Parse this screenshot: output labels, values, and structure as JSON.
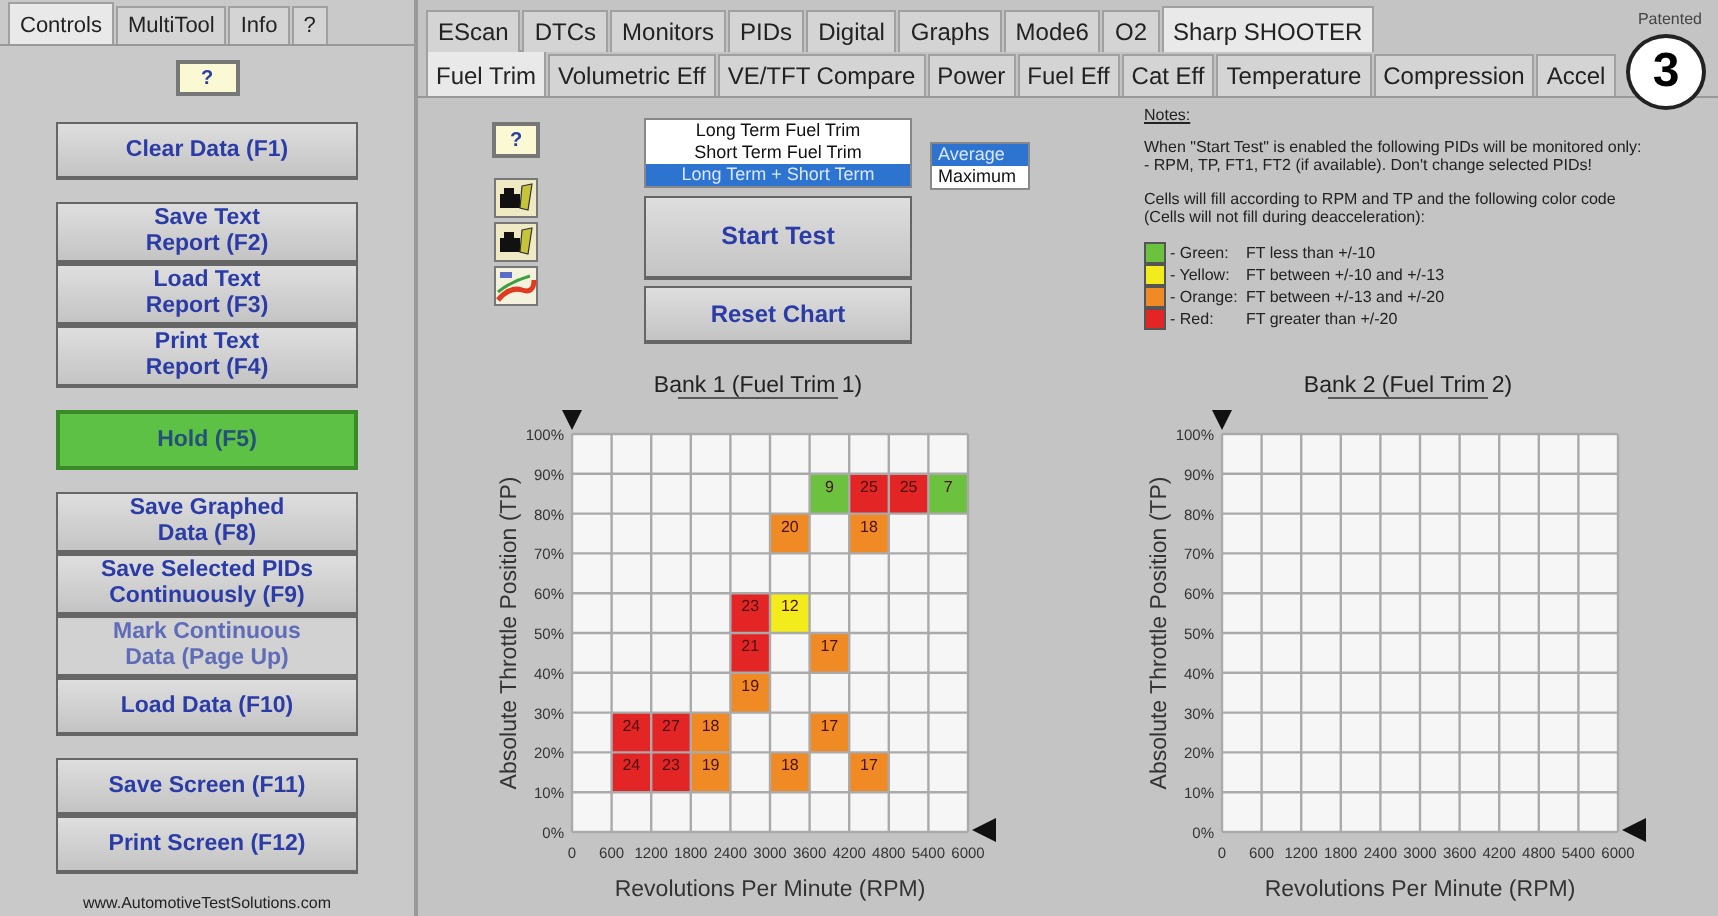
{
  "left_tabs": [
    {
      "label": "Controls",
      "selected": true
    },
    {
      "label": "MultiTool",
      "selected": false
    },
    {
      "label": "Info",
      "selected": false
    },
    {
      "label": "?",
      "selected": false
    }
  ],
  "help_button": "?",
  "button_groups": [
    [
      {
        "label": "Clear Data (F1)",
        "on": false,
        "disabled": false
      }
    ],
    [
      {
        "label": "Save Text\nReport (F2)",
        "on": false,
        "disabled": false
      },
      {
        "label": "Load Text\nReport (F3)",
        "on": false,
        "disabled": false
      },
      {
        "label": "Print Text\nReport (F4)",
        "on": false,
        "disabled": false
      }
    ],
    [
      {
        "label": "Hold (F5)",
        "on": true,
        "disabled": false
      }
    ],
    [
      {
        "label": "Save Graphed\nData (F8)",
        "on": false,
        "disabled": false
      },
      {
        "label": "Save Selected PIDs\nContinuously (F9)",
        "on": false,
        "disabled": false
      },
      {
        "label": "Mark Continuous\nData (Page Up)",
        "on": false,
        "disabled": true
      },
      {
        "label": "Load Data (F10)",
        "on": false,
        "disabled": false
      }
    ],
    [
      {
        "label": "Save Screen (F11)",
        "on": false,
        "disabled": false
      },
      {
        "label": "Print Screen (F12)",
        "on": false,
        "disabled": false
      }
    ]
  ],
  "footer": "www.AutomotiveTestSolutions.com",
  "main_tabs": [
    {
      "label": "EScan",
      "selected": false
    },
    {
      "label": "DTCs",
      "selected": false
    },
    {
      "label": "Monitors",
      "selected": false
    },
    {
      "label": "PIDs",
      "selected": false
    },
    {
      "label": "Digital",
      "selected": false
    },
    {
      "label": "Graphs",
      "selected": false
    },
    {
      "label": "Mode6",
      "selected": false
    },
    {
      "label": "O2",
      "selected": false
    },
    {
      "label": "Sharp SHOOTER",
      "selected": true
    }
  ],
  "patent_note": "Patented",
  "figure_badge": "3",
  "sub_tabs": [
    {
      "label": "Fuel Trim",
      "selected": true
    },
    {
      "label": "Volumetric Eff",
      "selected": false
    },
    {
      "label": "VE/TFT Compare",
      "selected": false
    },
    {
      "label": "Power",
      "selected": false
    },
    {
      "label": "Fuel Eff",
      "selected": false
    },
    {
      "label": "Cat Eff",
      "selected": false
    },
    {
      "label": "Temperature",
      "selected": false
    },
    {
      "label": "Compression",
      "selected": false
    },
    {
      "label": "Accel",
      "selected": false
    }
  ],
  "tool_help_button": "?",
  "trim_list": [
    {
      "label": "Long Term Fuel Trim",
      "selected": false
    },
    {
      "label": "Short Term Fuel Trim",
      "selected": false
    },
    {
      "label": "Long Term + Short Term",
      "selected": true
    }
  ],
  "mode_list": [
    {
      "label": "Average",
      "selected": true
    },
    {
      "label": "Maximum",
      "selected": false
    }
  ],
  "start_button": "Start Test",
  "reset_button": "Reset Chart",
  "notes": {
    "title": "Notes:",
    "lines": [
      "When \"Start Test\" is enabled the following PIDs will be monitored only:",
      "- RPM, TP, FT1, FT2 (if available).  Don't change selected PIDs!"
    ],
    "lines2": [
      "Cells will fill according to RPM and TP and the following color code",
      "(Cells will not fill during deacceleration):"
    ],
    "legend": [
      {
        "label": "- Green:",
        "text": "FT less than +/-10",
        "color": "#6cc13f"
      },
      {
        "label": "- Yellow:",
        "text": "FT between +/-10 and +/-13",
        "color": "#f2ec1c"
      },
      {
        "label": "- Orange:",
        "text": "FT between +/-13 and +/-20",
        "color": "#f08a24"
      },
      {
        "label": "- Red:",
        "text": "FT greater than +/-20",
        "color": "#e32526"
      }
    ]
  },
  "grids": [
    {
      "title": "Bank 1 (Fuel Trim 1)",
      "ylabel": "Absolute Throttle Position (TP)",
      "xlabel": "Revolutions Per Minute (RPM)",
      "yticks": [
        "100%",
        "90%",
        "80%",
        "70%",
        "60%",
        "50%",
        "40%",
        "30%",
        "20%",
        "10%",
        "0%"
      ],
      "xticks": [
        "0",
        "600",
        "1200",
        "1800",
        "2400",
        "3000",
        "3600",
        "4200",
        "4800",
        "5400",
        "6000"
      ],
      "rows": [
        [
          null,
          null,
          null,
          null,
          null,
          null,
          null,
          null,
          null,
          null
        ],
        [
          null,
          null,
          null,
          null,
          null,
          null,
          {
            "value": "9",
            "color": "#6cc13f"
          },
          {
            "value": "25",
            "color": "#e32526"
          },
          {
            "value": "25",
            "color": "#e32526"
          },
          {
            "value": "7",
            "color": "#6cc13f"
          }
        ],
        [
          null,
          null,
          null,
          null,
          null,
          {
            "value": "20",
            "color": "#f08a24"
          },
          null,
          {
            "value": "18",
            "color": "#f08a24"
          },
          null,
          null
        ],
        [
          null,
          null,
          null,
          null,
          null,
          null,
          null,
          null,
          null,
          null
        ],
        [
          null,
          null,
          null,
          null,
          {
            "value": "23",
            "color": "#e32526"
          },
          {
            "value": "12",
            "color": "#f2ec1c"
          },
          null,
          null,
          null,
          null
        ],
        [
          null,
          null,
          null,
          null,
          {
            "value": "21",
            "color": "#e32526"
          },
          null,
          {
            "value": "17",
            "color": "#f08a24"
          },
          null,
          null,
          null
        ],
        [
          null,
          null,
          null,
          null,
          {
            "value": "19",
            "color": "#f08a24"
          },
          null,
          null,
          null,
          null,
          null
        ],
        [
          null,
          {
            "value": "24",
            "color": "#e32526"
          },
          {
            "value": "27",
            "color": "#e32526"
          },
          {
            "value": "18",
            "color": "#f08a24"
          },
          null,
          null,
          {
            "value": "17",
            "color": "#f08a24"
          },
          null,
          null,
          null
        ],
        [
          null,
          {
            "value": "24",
            "color": "#e32526"
          },
          {
            "value": "23",
            "color": "#e32526"
          },
          {
            "value": "19",
            "color": "#f08a24"
          },
          null,
          {
            "value": "18",
            "color": "#f08a24"
          },
          null,
          {
            "value": "17",
            "color": "#f08a24"
          },
          null,
          null
        ],
        [
          null,
          null,
          null,
          null,
          null,
          null,
          null,
          null,
          null,
          null
        ]
      ]
    },
    {
      "title": "Bank 2 (Fuel Trim 2)",
      "ylabel": "Absolute Throttle Position (TP)",
      "xlabel": "Revolutions Per Minute (RPM)",
      "yticks": [
        "100%",
        "90%",
        "80%",
        "70%",
        "60%",
        "50%",
        "40%",
        "30%",
        "20%",
        "10%",
        "0%"
      ],
      "xticks": [
        "0",
        "600",
        "1200",
        "1800",
        "2400",
        "3000",
        "3600",
        "4200",
        "4800",
        "5400",
        "6000"
      ]
    }
  ]
}
